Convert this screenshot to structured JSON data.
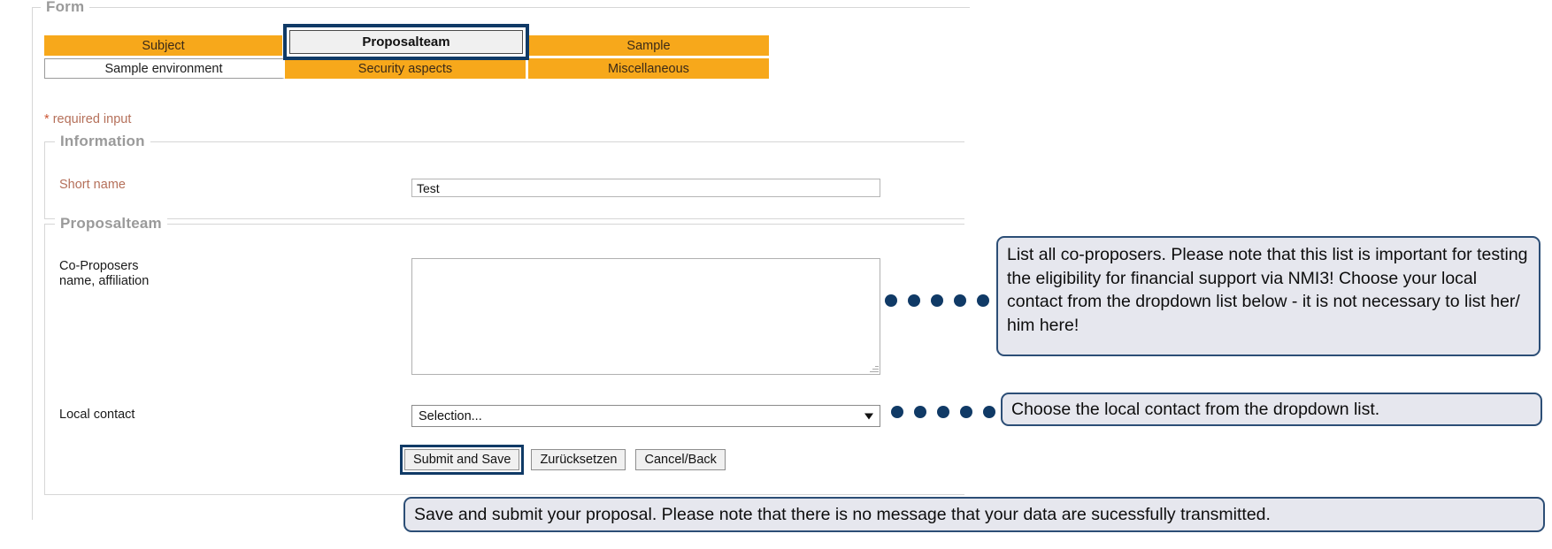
{
  "form": {
    "legend": "Form",
    "tabs_row1": [
      {
        "label": "Subject",
        "state": "orange"
      },
      {
        "label": "Proposalteam",
        "state": "active"
      },
      {
        "label": "Sample",
        "state": "orange"
      }
    ],
    "tabs_row2": [
      {
        "label": "Sample environment",
        "state": "white"
      },
      {
        "label": "Security aspects",
        "state": "orange"
      },
      {
        "label": "Miscellaneous",
        "state": "orange"
      }
    ],
    "required_star": "*",
    "required_note": "required input"
  },
  "information": {
    "legend": "Information",
    "short_name_label": "Short name",
    "short_name_value": "Test",
    "short_name_placeholder": ""
  },
  "proposalteam": {
    "legend": "Proposalteam",
    "coproposers_label_line1": "Co-Proposers",
    "coproposers_label_line2": "name, affiliation",
    "coproposers_value": "",
    "coproposers_placeholder": "",
    "local_contact_label": "Local contact",
    "local_contact_selected": "Selection...",
    "local_contact_options": [
      "Selection..."
    ]
  },
  "buttons": {
    "submit": "Submit and Save",
    "reset": "Zurücksetzen",
    "cancel": "Cancel/Back"
  },
  "callouts": {
    "coproposers": "List all co-proposers. Please note that this list is important for testing the eligibility for financial support via NMI3! Choose your local contact from the dropdown list below - it is not necessary to list her/ him here!",
    "local_contact": "Choose the local contact from the dropdown list.",
    "submit": "Save and submit your proposal. Please note that there is no message that your data are sucessfully transmitted."
  },
  "colors": {
    "tab_orange": "#f7a81b",
    "highlight_blue": "#103a66",
    "callout_border": "#2c4e76",
    "callout_fill": "#e6e7ee",
    "label_red": "#b5705a",
    "legend_gray": "#9a9a9a"
  }
}
